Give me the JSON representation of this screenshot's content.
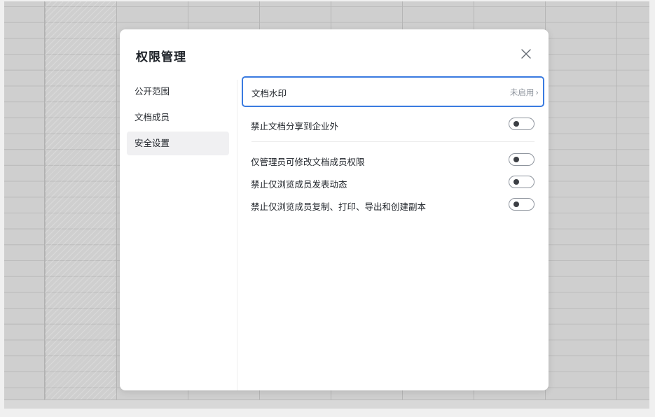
{
  "dialog": {
    "title": "权限管理",
    "close_icon": "close-icon"
  },
  "nav": {
    "items": [
      {
        "label": "公开范围",
        "active": false
      },
      {
        "label": "文档成员",
        "active": false
      },
      {
        "label": "安全设置",
        "active": true
      }
    ]
  },
  "security": {
    "watermark": {
      "label": "文档水印",
      "status": "未启用",
      "chevron": "›"
    },
    "external_share": {
      "label": "禁止文档分享到企业外",
      "enabled": false
    },
    "toggles": [
      {
        "label": "仅管理员可修改文档成员权限",
        "enabled": false
      },
      {
        "label": "禁止仅浏览成员发表动态",
        "enabled": false
      },
      {
        "label": "禁止仅浏览成员复制、打印、导出和创建副本",
        "enabled": false
      }
    ]
  },
  "colors": {
    "focus_border": "#3a7be0",
    "toggle_knob": "#3c3f44",
    "muted_text": "#8f959e"
  }
}
